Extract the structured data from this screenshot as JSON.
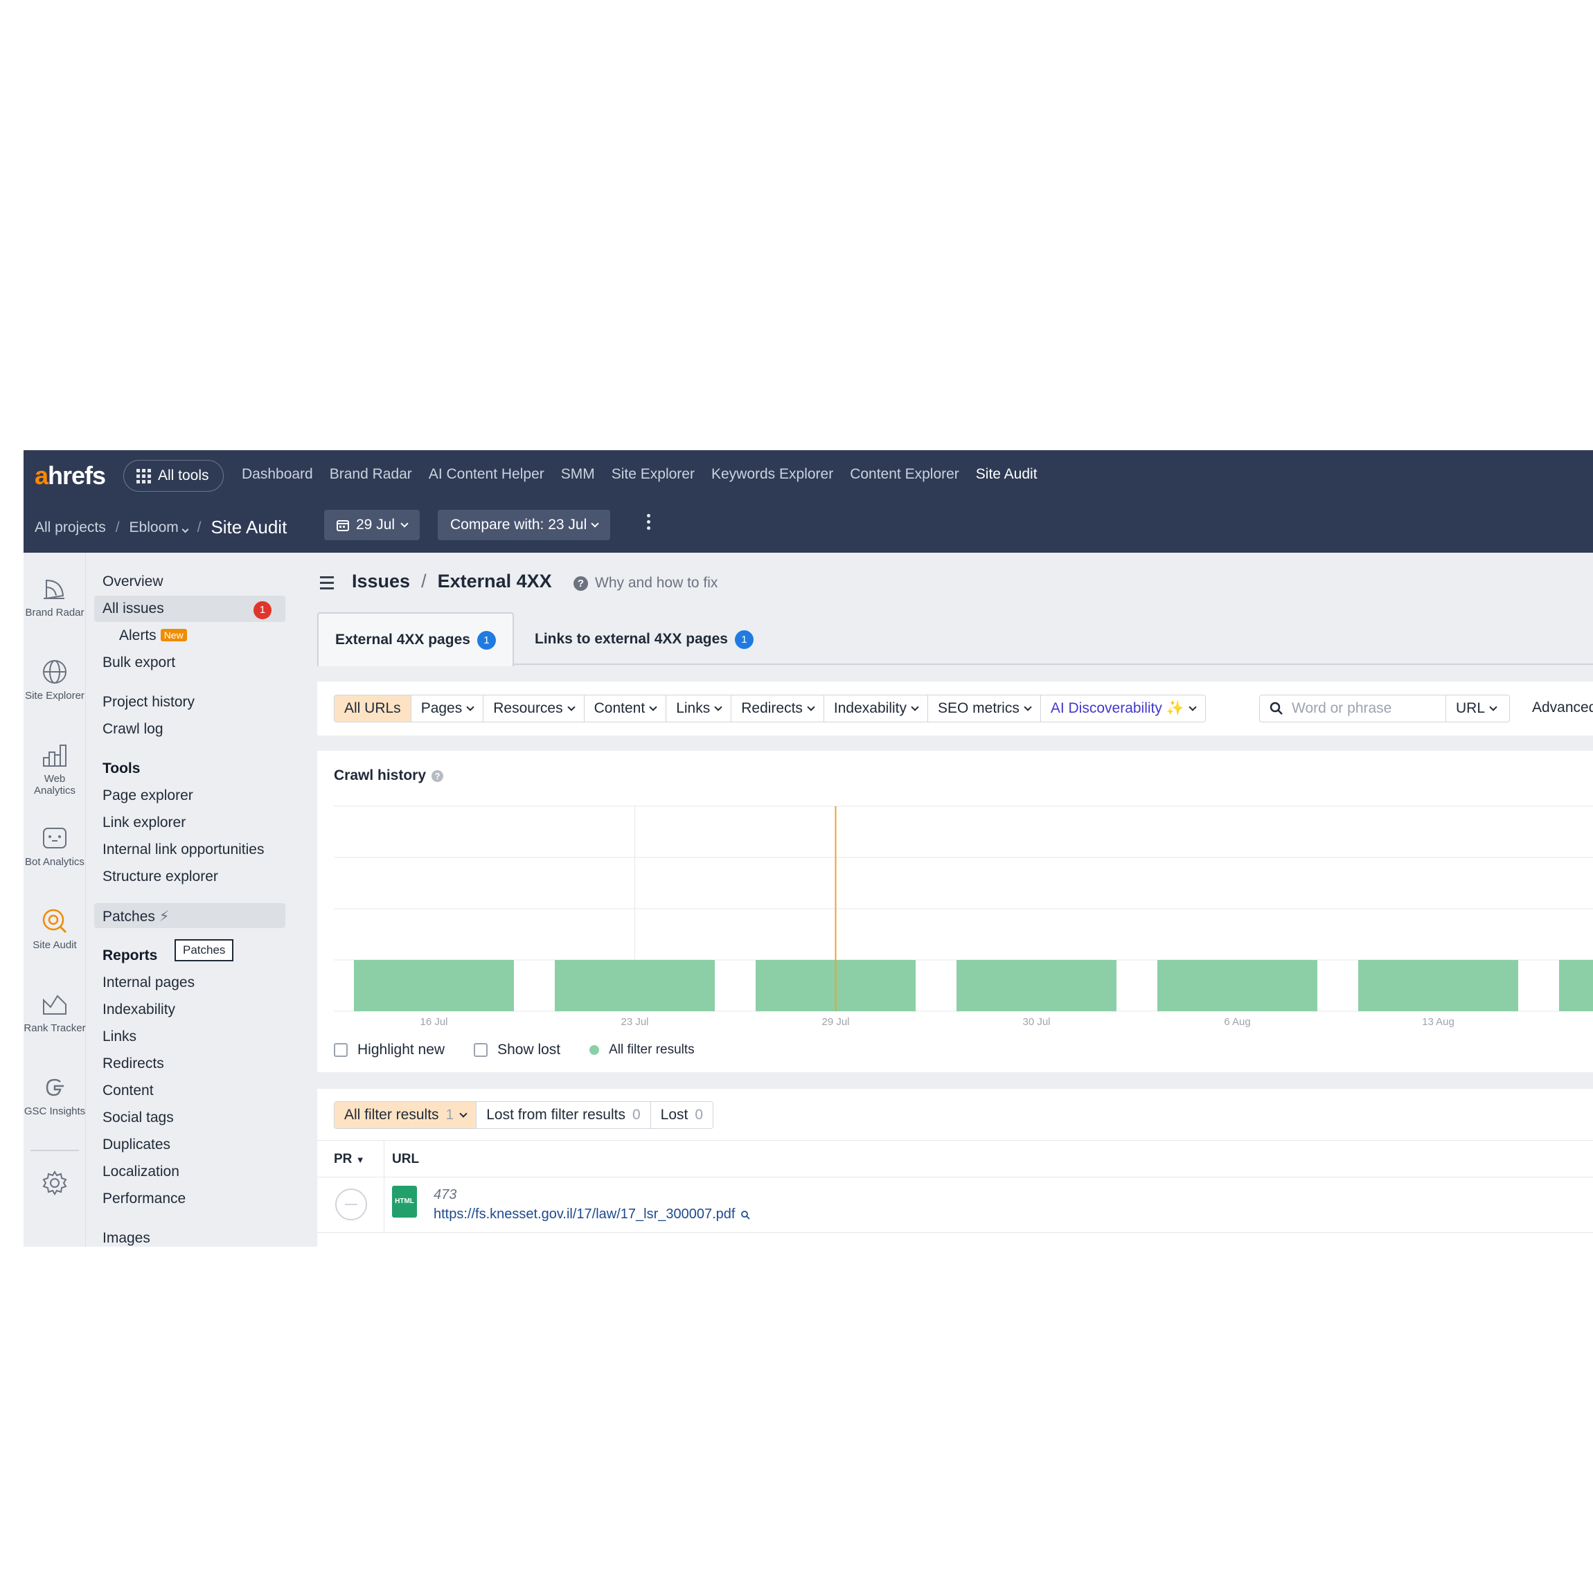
{
  "app": {
    "logo": "ahrefs",
    "all_tools": "All tools",
    "nav": [
      "Dashboard",
      "Brand Radar",
      "AI Content Helper",
      "SMM",
      "Site Explorer",
      "Keywords Explorer",
      "Content Explorer",
      "Site Audit"
    ],
    "nav_active": "Site Audit"
  },
  "breadcrumbs": {
    "all_projects": "All projects",
    "project": "Ebloom",
    "current": "Site Audit"
  },
  "toolbar": {
    "date": "29 Jul",
    "compare": "Compare with: 23 Jul"
  },
  "rail": [
    {
      "label": "Brand Radar",
      "icon": "brand-radar-icon"
    },
    {
      "label": "Site Explorer",
      "icon": "globe-icon"
    },
    {
      "label": "Web Analytics",
      "icon": "bar-chart-icon"
    },
    {
      "label": "Bot Analytics",
      "icon": "bot-icon"
    },
    {
      "label": "Site Audit",
      "icon": "site-audit-icon",
      "active": true
    },
    {
      "label": "Rank Tracker",
      "icon": "rank-tracker-icon"
    },
    {
      "label": "GSC Insights",
      "icon": "google-icon"
    },
    {
      "label": "",
      "icon": "gear-icon"
    }
  ],
  "sidebar": {
    "overview": "Overview",
    "all_issues": "All issues",
    "all_issues_badge": "1",
    "alerts": "Alerts",
    "alerts_badge": "New",
    "bulk_export": "Bulk export",
    "project_history": "Project history",
    "crawl_log": "Crawl log",
    "tools_heading": "Tools",
    "tools": [
      "Page explorer",
      "Link explorer",
      "Internal link opportunities",
      "Structure explorer"
    ],
    "patches": "Patches",
    "reports_heading": "Reports",
    "tooltip": "Patches",
    "reports": [
      "Internal pages",
      "Indexability",
      "Links",
      "Redirects",
      "Content",
      "Social tags",
      "Duplicates",
      "Localization",
      "Performance",
      "Images"
    ]
  },
  "main": {
    "title_issues": "Issues",
    "title_current": "External 4XX",
    "why": "Why and how to fix",
    "tabs": [
      {
        "label": "External 4XX pages",
        "count": "1"
      },
      {
        "label": "Links to external 4XX pages",
        "count": "1"
      }
    ],
    "filters": [
      "All URLs",
      "Pages",
      "Resources",
      "Content",
      "Links",
      "Redirects",
      "Indexability",
      "SEO metrics",
      "AI Discoverability ✨"
    ],
    "search_placeholder": "Word or phrase",
    "search_mode": "URL",
    "advanced": "Advanced filter"
  },
  "chart_data": {
    "type": "bar",
    "title": "Crawl history",
    "categories": [
      "16 Jul",
      "23 Jul",
      "29 Jul",
      "30 Jul",
      "6 Aug",
      "13 Aug",
      ""
    ],
    "values": [
      1,
      1,
      1,
      1,
      1,
      1,
      1
    ],
    "ylim": [
      0,
      4
    ],
    "highlight_category": "29 Jul",
    "series_color": "#8ccfa7",
    "highlight_color": "#f0a030",
    "grid": true,
    "legend": [
      "Highlight new",
      "Show lost",
      "All filter results"
    ]
  },
  "results": {
    "tabs": [
      {
        "label": "All filter results",
        "count": "1"
      },
      {
        "label": "Lost from filter results",
        "count": "0"
      },
      {
        "label": "Lost",
        "count": "0"
      }
    ],
    "columns": [
      "PR",
      "URL"
    ],
    "rows": [
      {
        "number": "473",
        "url": "https://fs.knesset.gov.il/17/law/17_lsr_300007.pdf",
        "file_type": "HTML"
      }
    ]
  }
}
